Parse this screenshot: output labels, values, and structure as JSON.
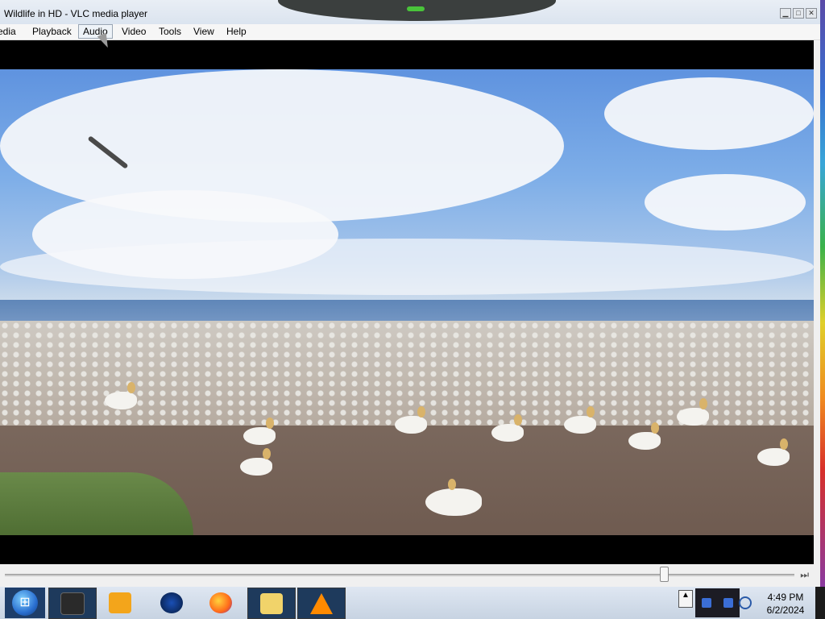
{
  "window": {
    "title": "Wildlife in HD - VLC media player",
    "controls": {
      "minimize": "▁",
      "maximize": "□",
      "close": "✕"
    }
  },
  "menubar": {
    "items": [
      "Media",
      "Playback",
      "Audio",
      "Video",
      "Tools",
      "View",
      "Help"
    ],
    "active": "Audio"
  },
  "player": {
    "seek_fraction": 0.83,
    "skip_icon": "⏭"
  },
  "taskbar": {
    "start_icon": "windows-orb",
    "apps": [
      "terminal-app",
      "media-player-app",
      "globe-app",
      "firefox-app",
      "file-explorer-app",
      "vlc-app"
    ],
    "clock_time": "4:49 PM",
    "clock_date": "6/2/2024"
  },
  "colors": {
    "accent": "#1e3e6a",
    "video_bg": "#000000"
  }
}
